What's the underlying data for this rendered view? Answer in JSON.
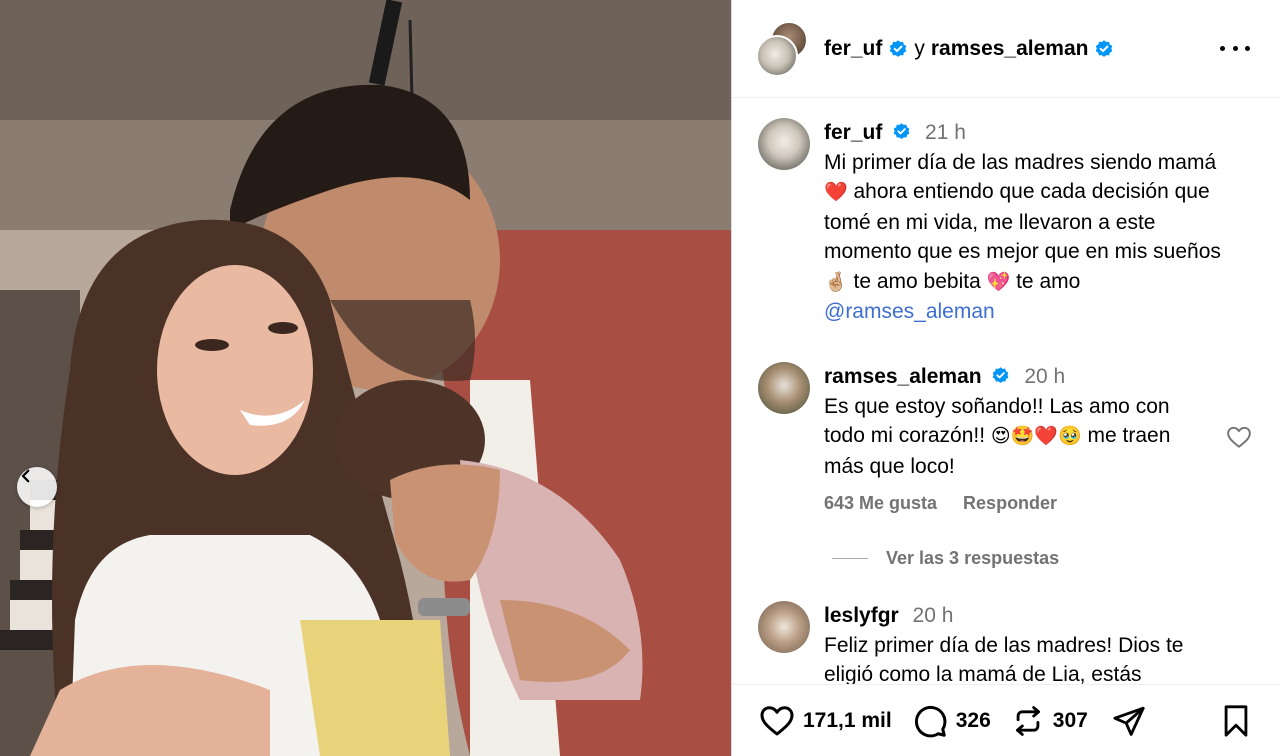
{
  "header": {
    "user1": "fer_uf",
    "joiner": "y",
    "user2": "ramses_aleman"
  },
  "caption": {
    "username": "fer_uf",
    "time": "21 h",
    "text_a": "Mi primer día de las madres siendo mamá ",
    "heart": "❤️",
    "text_b": " ahora entiendo que cada decisión que tomé en mi vida, me llevaron a este momento que es mejor que en mis sueños ",
    "hand": "🤞🏼",
    "text_c": " te amo bebita ",
    "sparkle": "💖",
    "text_d": " te amo ",
    "mention": "@ramses_aleman"
  },
  "comment1": {
    "username": "ramses_aleman",
    "time": "20 h",
    "text_a": "Es que estoy soñando!! Las amo con todo mi corazón!! ",
    "emojis": "😍🤩❤️🥹",
    "text_b": " me traen más que loco!",
    "likes": "643 Me gusta",
    "reply": "Responder"
  },
  "view_replies": "Ver las 3 respuestas",
  "comment2": {
    "username": "leslyfgr",
    "time": "20 h",
    "text": "Feliz primer día de las madres! Dios te eligió como la mamá de Lia, estás"
  },
  "actions": {
    "likes": "171,1 mil",
    "comments": "326",
    "reposts": "307"
  },
  "colors": {
    "verified": "#0095f6",
    "muted": "#737373",
    "mention": "#3e6ed1"
  }
}
